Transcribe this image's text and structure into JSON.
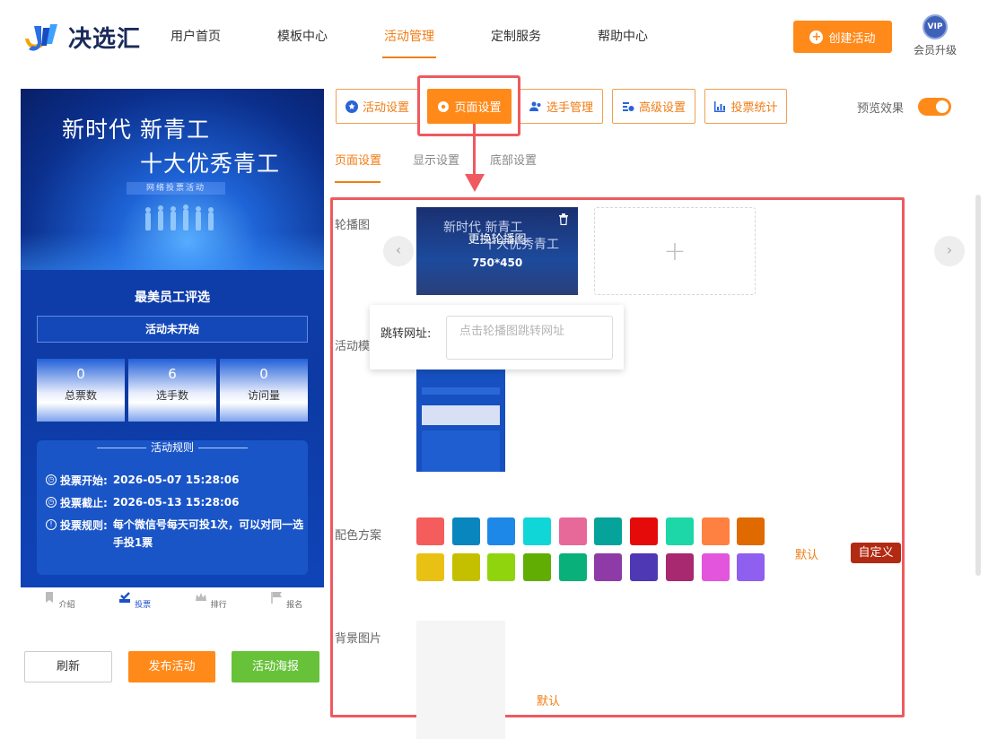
{
  "brand": {
    "name": "决选汇"
  },
  "nav": {
    "items": [
      {
        "label": "用户首页",
        "active": false
      },
      {
        "label": "模板中心",
        "active": false
      },
      {
        "label": "活动管理",
        "active": true
      },
      {
        "label": "定制服务",
        "active": false
      },
      {
        "label": "帮助中心",
        "active": false
      }
    ],
    "create_label": "创建活动",
    "vip_badge": "VIP",
    "vip_label": "会员升级"
  },
  "preview": {
    "banner_line1": "新时代 新青工",
    "banner_line2": "十大优秀青工",
    "banner_tag": "网络投票活动",
    "title": "最美员工评选",
    "status": "活动未开始",
    "stats": [
      {
        "value": "0",
        "label": "总票数"
      },
      {
        "value": "6",
        "label": "选手数"
      },
      {
        "value": "0",
        "label": "访问量"
      }
    ],
    "rules_title": "活动规则",
    "rules": [
      {
        "key": "投票开始:",
        "value": "2026-05-07 15:28:06"
      },
      {
        "key": "投票截止:",
        "value": "2026-05-13 15:28:06"
      },
      {
        "key": "投票规则:",
        "value": "每个微信号每天可投1次，可以对同一选手投1票"
      }
    ],
    "tabs": [
      {
        "label": "介绍",
        "icon": "bookmark-icon"
      },
      {
        "label": "投票",
        "icon": "vote-check-icon"
      },
      {
        "label": "排行",
        "icon": "crown-icon"
      },
      {
        "label": "报名",
        "icon": "flag-icon"
      }
    ]
  },
  "actions": {
    "refresh": "刷新",
    "publish": "发布活动",
    "poster": "活动海报"
  },
  "settings": {
    "tabs": [
      {
        "label": "活动设置",
        "icon": "star-icon"
      },
      {
        "label": "页面设置",
        "icon": "gear-icon"
      },
      {
        "label": "选手管理",
        "icon": "users-icon"
      },
      {
        "label": "高级设置",
        "icon": "sliders-icon"
      },
      {
        "label": "投票统计",
        "icon": "bar-chart-icon"
      }
    ],
    "preview_label": "预览效果",
    "subtabs": [
      "页面设置",
      "显示设置",
      "底部设置"
    ]
  },
  "page_settings": {
    "carousel_label": "轮播图",
    "carousel_bg_line1": "新时代 新青工",
    "carousel_bg_line2": "十大优秀青工",
    "carousel_overlay": "更换轮播图",
    "carousel_size": "750*450",
    "add_symbol": "+",
    "prev_symbol": "‹",
    "next_symbol": "›",
    "link_label": "跳转网址:",
    "link_placeholder": "点击轮播图跳转网址",
    "template_label": "活动模",
    "color_label": "配色方案",
    "colors": [
      "#f55c5c",
      "#0a86be",
      "#1e88e8",
      "#10d6d8",
      "#e6699a",
      "#06a39a",
      "#e50b0b",
      "#1dd7a8",
      "#ff8142",
      "#e06a00",
      "#e9c114",
      "#c4c000",
      "#8fd40c",
      "#62ad04",
      "#09b07a",
      "#8e3ba8",
      "#4e38b4",
      "#a8296f",
      "#e355dc",
      "#8f5fef"
    ],
    "default_label": "默认",
    "custom_label": "自定义",
    "bg_label": "背景图片",
    "bg_default_label": "默认"
  }
}
